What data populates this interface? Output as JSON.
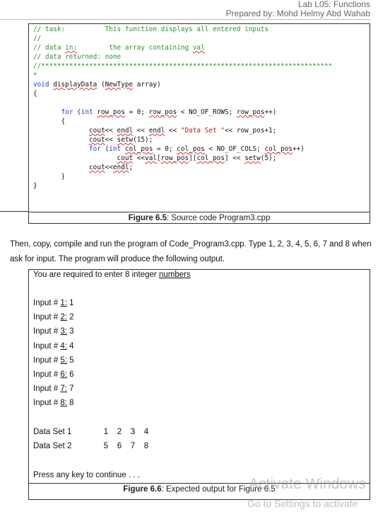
{
  "header": {
    "lab": "Lab L05: Functions",
    "author": "Prepared by: Mohd Helmy Abd Wahab"
  },
  "code": {
    "lines": [
      {
        "parts": [
          {
            "t": "// task:          This function displays all entered inputs",
            "c": "cmt"
          }
        ]
      },
      {
        "parts": [
          {
            "t": "//",
            "c": "cmt"
          }
        ]
      },
      {
        "parts": [
          {
            "t": "// data ",
            "c": "cmt"
          },
          {
            "t": "in:",
            "c": "cmt u"
          },
          {
            "t": "        the array containing ",
            "c": "cmt"
          },
          {
            "t": "val",
            "c": "cmt u"
          }
        ]
      },
      {
        "parts": [
          {
            "t": "// data returned: none",
            "c": "cmt"
          }
        ]
      },
      {
        "parts": [
          {
            "t": "//*************************************************************************",
            "c": "cmt"
          }
        ]
      },
      {
        "parts": [
          {
            "t": "*",
            "c": "cmt"
          }
        ]
      },
      {
        "parts": [
          {
            "t": "void ",
            "c": "kw"
          },
          {
            "t": "displayData",
            "c": "u"
          },
          {
            "t": " ("
          },
          {
            "t": "NewType",
            "c": "u"
          },
          {
            "t": " array)"
          }
        ]
      },
      {
        "parts": [
          {
            "t": "{"
          }
        ]
      },
      {
        "parts": [
          {
            "t": ""
          }
        ]
      },
      {
        "parts": [
          {
            "t": "       "
          },
          {
            "t": "for",
            "c": "kw"
          },
          {
            "t": " ("
          },
          {
            "t": "int",
            "c": "kw"
          },
          {
            "t": " "
          },
          {
            "t": "row_pos",
            "c": "u"
          },
          {
            "t": " = 0; "
          },
          {
            "t": "row_pos",
            "c": "u"
          },
          {
            "t": " < NO_OF_ROWS; "
          },
          {
            "t": "row_pos",
            "c": "u"
          },
          {
            "t": "++)"
          }
        ]
      },
      {
        "parts": [
          {
            "t": "       {"
          }
        ]
      },
      {
        "parts": [
          {
            "t": "              "
          },
          {
            "t": "cout",
            "c": "u"
          },
          {
            "t": "<< "
          },
          {
            "t": "endl",
            "c": "u"
          },
          {
            "t": " << "
          },
          {
            "t": "endl",
            "c": "u"
          },
          {
            "t": " << "
          },
          {
            "t": "\"Data Set \"",
            "c": "str"
          },
          {
            "t": "<< row_pos+1;"
          }
        ]
      },
      {
        "parts": [
          {
            "t": "              "
          },
          {
            "t": "cout",
            "c": "u"
          },
          {
            "t": "<< "
          },
          {
            "t": "setw",
            "c": "u"
          },
          {
            "t": "(15);"
          }
        ]
      },
      {
        "parts": [
          {
            "t": "              "
          },
          {
            "t": "for",
            "c": "kw"
          },
          {
            "t": " ("
          },
          {
            "t": "int",
            "c": "kw"
          },
          {
            "t": " "
          },
          {
            "t": "col_pos",
            "c": "u"
          },
          {
            "t": " = 0; "
          },
          {
            "t": "col_pos",
            "c": "u"
          },
          {
            "t": " < NO_OF_COLS; "
          },
          {
            "t": "col_pos",
            "c": "u"
          },
          {
            "t": "++)"
          }
        ]
      },
      {
        "parts": [
          {
            "t": "                     "
          },
          {
            "t": "cout",
            "c": "u"
          },
          {
            "t": " <<"
          },
          {
            "t": "val",
            "c": "u"
          },
          {
            "t": "["
          },
          {
            "t": "row_pos",
            "c": "u"
          },
          {
            "t": "]["
          },
          {
            "t": "col_pos",
            "c": "u"
          },
          {
            "t": "] << "
          },
          {
            "t": "setw",
            "c": "u"
          },
          {
            "t": "(5);"
          }
        ]
      },
      {
        "parts": [
          {
            "t": "              "
          },
          {
            "t": "cout",
            "c": "u"
          },
          {
            "t": "<<"
          },
          {
            "t": "endl",
            "c": "u"
          },
          {
            "t": ";"
          }
        ]
      },
      {
        "parts": [
          {
            "t": "       }"
          }
        ]
      },
      {
        "parts": [
          {
            "t": "}"
          }
        ]
      }
    ]
  },
  "figure_1": {
    "label": "Figure 6.5",
    "caption": ": Source code Program3.cpp"
  },
  "paragraph": "Then, copy, compile and run the program of Code_Program3.cpp. Type 1, 2, 3, 4, 5, 6, 7 and 8 when ask for input. The program will produce the following output.",
  "output": {
    "intro_prefix": "You are required to enter 8 integer ",
    "intro_word": "numbers",
    "inputs": [
      {
        "label": "Input # ",
        "num": "1:",
        "value": " 1"
      },
      {
        "label": "Input # ",
        "num": "2:",
        "value": " 2"
      },
      {
        "label": "Input # ",
        "num": "3:",
        "value": " 3"
      },
      {
        "label": "Input # ",
        "num": "4:",
        "value": " 4"
      },
      {
        "label": "Input # ",
        "num": "5:",
        "value": " 5"
      },
      {
        "label": "Input # ",
        "num": "6:",
        "value": " 6"
      },
      {
        "label": "Input # ",
        "num": "7:",
        "value": " 7"
      },
      {
        "label": "Input # ",
        "num": "8:",
        "value": " 8"
      }
    ],
    "data_sets": [
      {
        "label": "Data Set 1",
        "values": [
          "1",
          "2",
          "3",
          "4"
        ]
      },
      {
        "label": "Data Set 2",
        "values": [
          "5",
          "6",
          "7",
          "8"
        ]
      }
    ],
    "footer": "Press any key to continue . . ."
  },
  "figure_2": {
    "label": "Figure 6.6",
    "caption": ": Expected output for Figure 6.5"
  },
  "watermark": {
    "line1": "Activate Windows",
    "line2": "Go to Settings to activate"
  }
}
